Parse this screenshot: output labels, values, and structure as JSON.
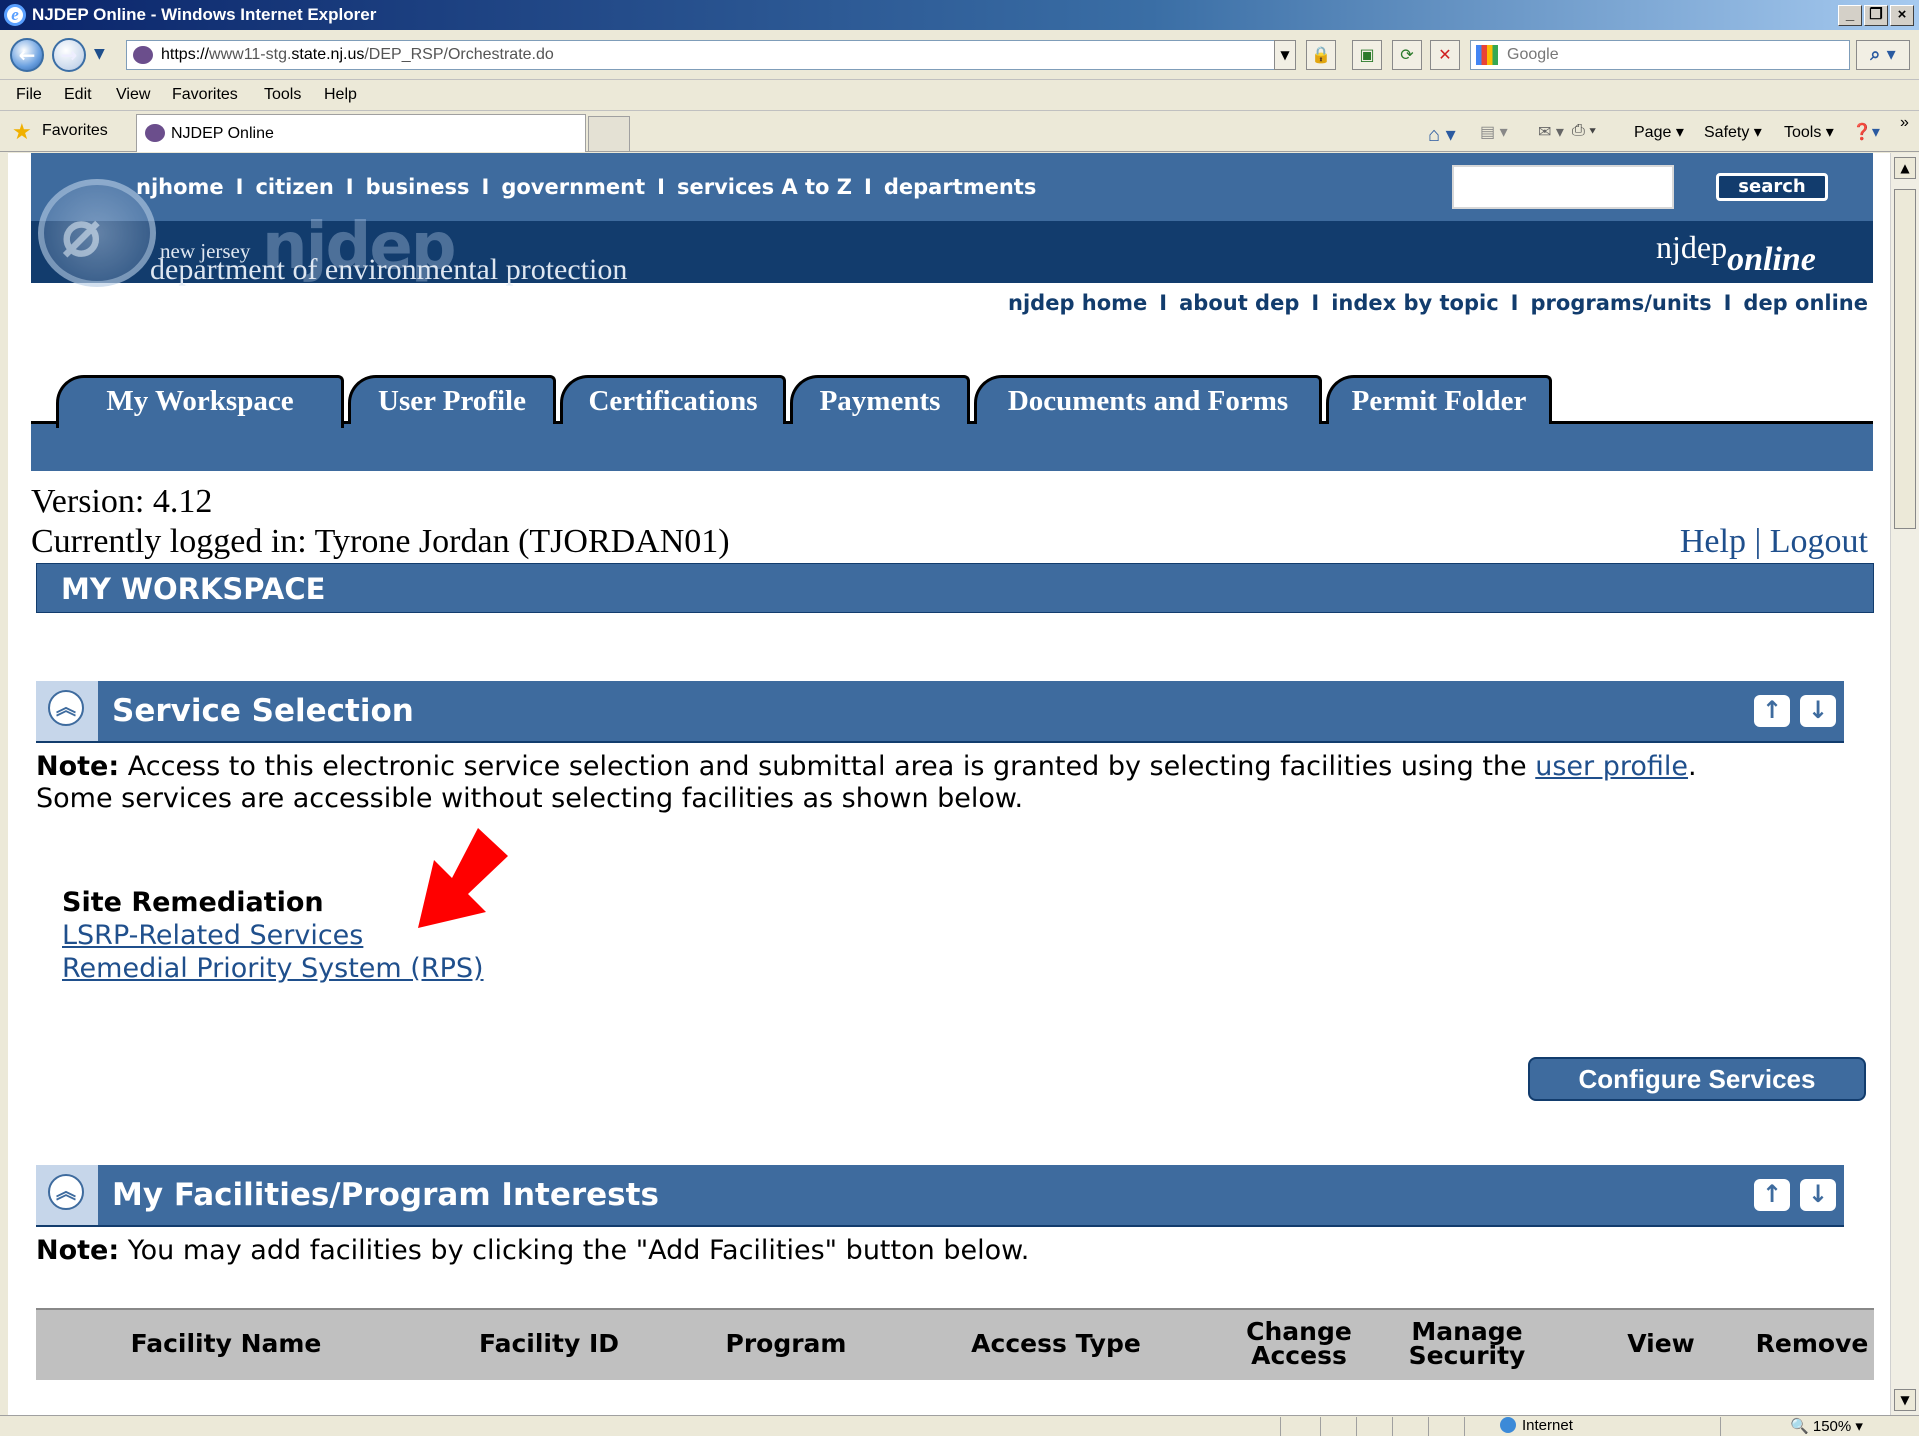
{
  "window": {
    "title": "NJDEP Online - Windows Internet Explorer",
    "controls": {
      "minimize": "_",
      "restore": "❐",
      "close": "×"
    }
  },
  "address_bar": {
    "url_prefix": "https://",
    "url_sub": "www11-stg.",
    "url_domain": "state.nj.us",
    "url_path": "/DEP_RSP/Orchestrate.do",
    "search_placeholder": "Google"
  },
  "menu": [
    "File",
    "Edit",
    "View",
    "Favorites",
    "Tools",
    "Help"
  ],
  "favorites_bar": {
    "favorites_label": "Favorites",
    "tab_label": "NJDEP Online",
    "commands": [
      "Page ▾",
      "Safety ▾",
      "Tools ▾"
    ]
  },
  "header": {
    "topnav": [
      "njhome",
      "citizen",
      "business",
      "government",
      "services A to Z",
      "departments"
    ],
    "search_button": "search",
    "agency_big": "njdep",
    "agency_line1": "new jersey",
    "agency_line2": "department of environmental protection",
    "online_prefix": "njdep",
    "online_suffix": "online",
    "subnav": [
      "njdep home",
      "about dep",
      "index by topic",
      "programs/units",
      "dep online"
    ],
    "separator": "I"
  },
  "tabs": [
    "My Workspace",
    "User Profile",
    "Certifications",
    "Payments",
    "Documents and Forms",
    "Permit Folder"
  ],
  "session": {
    "version": "Version: 4.12",
    "logged_in": "Currently logged in: Tyrone Jordan (TJORDAN01)",
    "help": "Help",
    "pipe": "|",
    "logout": "Logout"
  },
  "workspace_title": "MY WORKSPACE",
  "service_selection": {
    "title": "Service Selection",
    "note_label": "Note:",
    "note_text": " Access to this electronic service selection and submittal area is granted by selecting facilities using the ",
    "note_link": "user profile",
    "note_end": ".",
    "note_line2": "Some services are accessible without selecting facilities as shown below.",
    "group_title": "Site Remediation",
    "links": [
      "LSRP-Related Services",
      "Remedial Priority System (RPS)"
    ],
    "configure_button": "Configure Services"
  },
  "facilities": {
    "title": "My Facilities/Program Interests",
    "note_label": "Note:",
    "note_text": " You may add facilities by clicking the \"Add Facilities\" button below.",
    "columns": [
      "Facility Name",
      "Facility ID",
      "Program",
      "Access Type",
      "Change Access",
      "Manage Security",
      "View",
      "Remove"
    ]
  },
  "status_bar": {
    "zone": "Internet",
    "zoom": "150%"
  },
  "colors": {
    "header_blue": "#3e6b9e",
    "header_dark": "#123c6d",
    "link_blue": "#1f4f8c",
    "arrow_red": "#ff0000"
  }
}
